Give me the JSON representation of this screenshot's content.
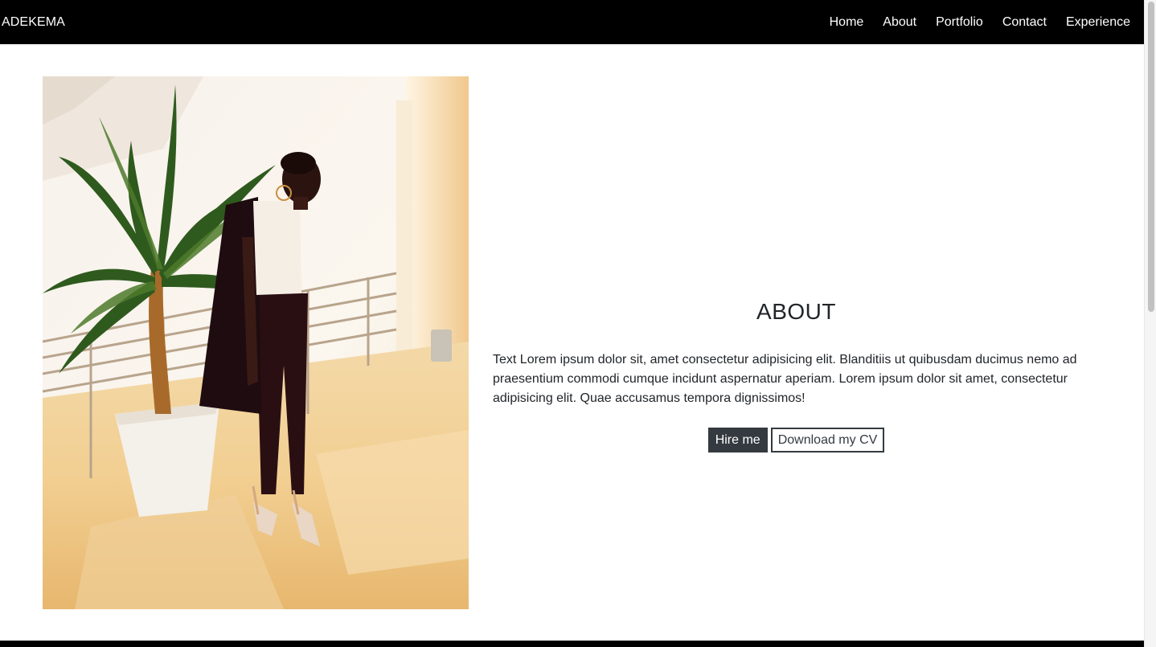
{
  "navbar": {
    "brand": "ADEKEMA",
    "links": [
      "Home",
      "About",
      "Portfolio",
      "Contact",
      "Experience"
    ]
  },
  "photo": {
    "alt": "Woman standing beside a potted plant"
  },
  "about": {
    "title": "ABOUT",
    "text": "Text Lorem ipsum dolor sit, amet consectetur adipisicing elit. Blanditiis ut quibusdam ducimus nemo ad praesentium commodi cumque incidunt aspernatur aperiam. Lorem ipsum dolor sit amet, consectetur adipisicing elit. Quae accusamus tempora dignissimos!",
    "hire_label": "Hire me",
    "cv_label": "Download my CV"
  },
  "colors": {
    "navbar_bg": "#000000",
    "button_dark": "#343a40",
    "text": "#212529"
  }
}
